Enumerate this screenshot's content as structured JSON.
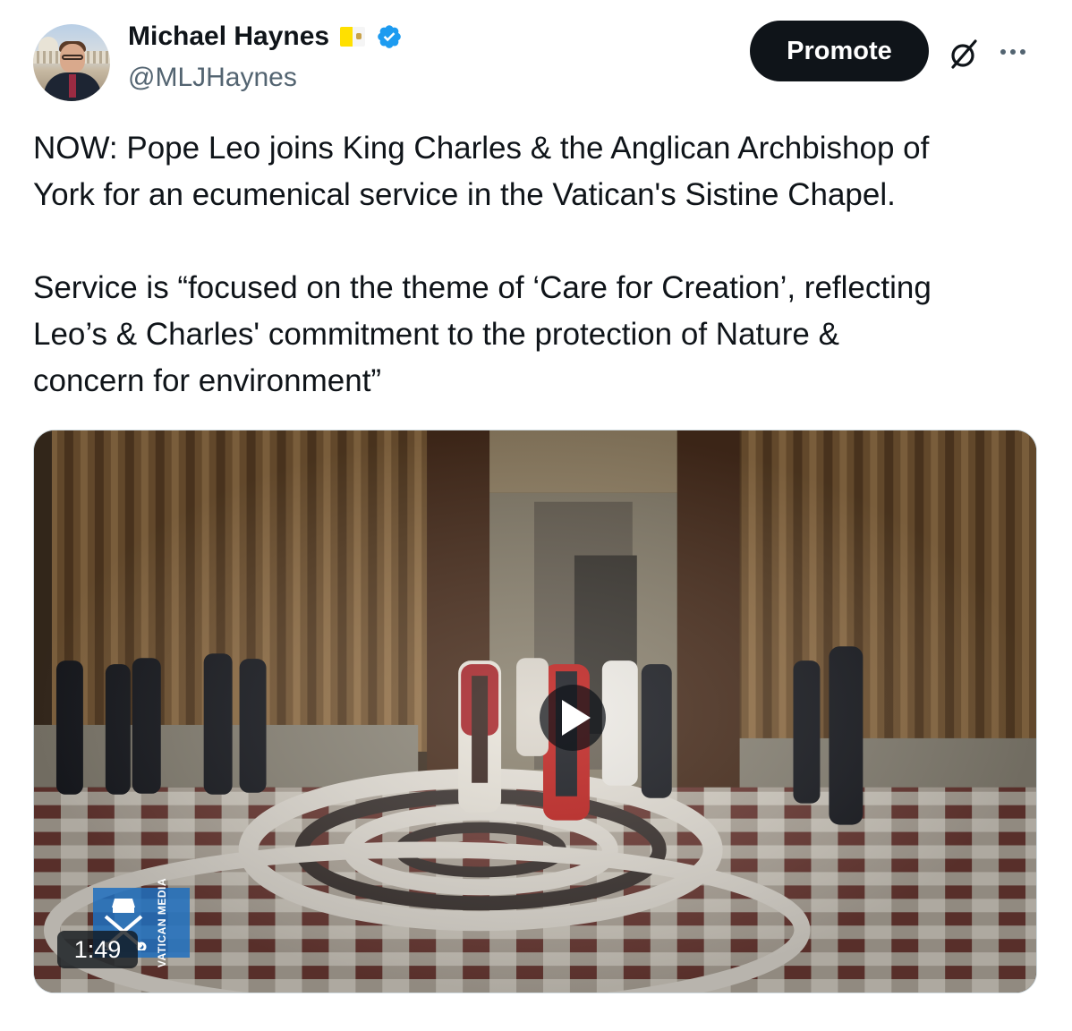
{
  "author": {
    "name": "Michael Haynes",
    "handle": "@MLJHaynes",
    "verified": true,
    "flag": "vatican-flag",
    "accent_color": "#1d9bf0"
  },
  "actions": {
    "promote_label": "Promote",
    "grok_icon": "slashed-circle-icon",
    "more_icon": "more-horizontal-icon"
  },
  "tweet": {
    "line1": "NOW: Pope Leo joins King Charles & the Anglican Archbishop of",
    "line2": "York for an ecumenical service in the Vatican's Sistine Chapel.",
    "line3": "Service is “focused on the theme of ‘Care for Creation’, reflecting",
    "line4": "Leo’s & Charles' commitment to the protection of Nature &",
    "line5": "concern for environment”"
  },
  "media": {
    "duration": "1:49",
    "watermark_label": "VATICAN MEDIA",
    "play_icon": "play-icon"
  }
}
